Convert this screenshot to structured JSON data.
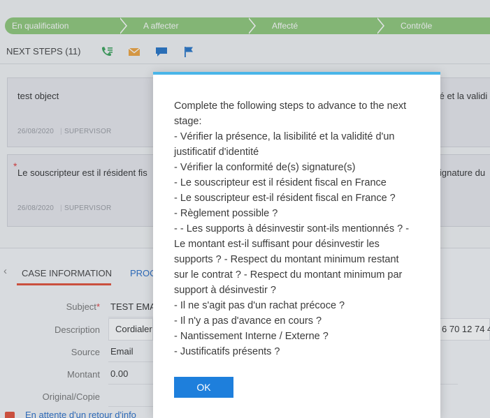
{
  "stages": [
    "En qualification",
    "A affecter",
    "Affecté",
    "Contrôle"
  ],
  "next_steps": {
    "title": "NEXT STEPS (11)",
    "icons": [
      {
        "name": "phone-list-icon",
        "color": "#3aa35a"
      },
      {
        "name": "envelope-icon",
        "color": "#f0a540"
      },
      {
        "name": "chat-bubble-icon",
        "color": "#2574c8"
      },
      {
        "name": "flag-icon",
        "color": "#2574c8"
      }
    ],
    "cards": [
      {
        "text": "test object",
        "date": "26/08/2020",
        "owner": "SUPERVISOR",
        "right_text": "té et la validi",
        "required": false
      },
      {
        "text": "Le souscripteur est il résident fis",
        "date": "26/08/2020",
        "owner": "SUPERVISOR",
        "right_text": "ignature du",
        "required": true
      }
    ]
  },
  "case": {
    "tabs": [
      "CASE INFORMATION",
      "PROC"
    ],
    "fields": [
      {
        "label": "Subject",
        "required": true,
        "value": "TEST EMA"
      },
      {
        "label": "Description",
        "required": false,
        "value": "Cordialer",
        "right_value": "6 70 12 74 4"
      },
      {
        "label": "Source",
        "required": false,
        "value": "Email"
      },
      {
        "label": "Montant",
        "required": false,
        "value": "0.00"
      },
      {
        "label": "Original/Copie",
        "required": false,
        "value": ""
      }
    ],
    "status_link": "En attente d'un retour d'info"
  },
  "modal": {
    "lines": [
      "Complete the following steps to advance to the next",
      "stage:",
      "- Vérifier la présence, la lisibilité et la validité d'un",
      "justificatif d'identité",
      "- Vérifier la conformité de(s) signature(s)",
      "- Le souscripteur est il résident fiscal en France",
      "- Le souscripteur est-il résident fiscal en France ?",
      "- Règlement possible ?",
      "- - Les supports à désinvestir sont-ils mentionnés ? -",
      "Le montant est-il suffisant pour désinvestir les",
      "supports ? - Respect du montant minimum restant",
      "sur le contrat ? - Respect du montant minimum par",
      "support à désinvestir ?",
      "- Il ne s'agit pas d'un rachat précoce ?",
      "- Il n'y a pas d'avance en cours ?",
      "- Nantissement Interne / Externe ?",
      "- Justificatifs présents ?"
    ],
    "ok_label": "OK"
  },
  "colors": {
    "stage": "#8fc97a",
    "accent_tab": "#e4503a",
    "link": "#2a6fc9",
    "modal_top": "#4ab5e8",
    "ok": "#1e7fdc"
  }
}
